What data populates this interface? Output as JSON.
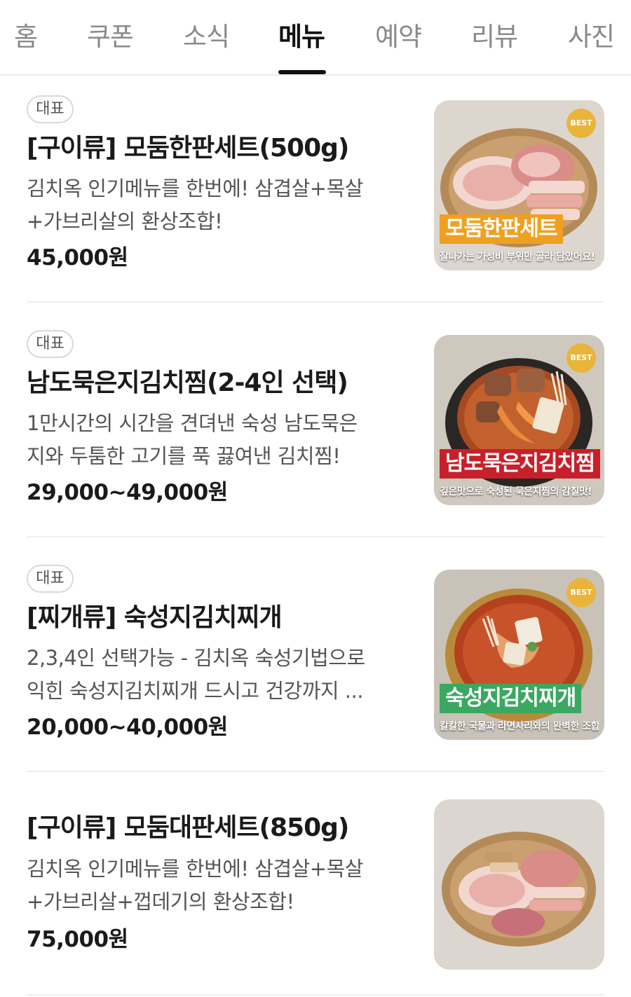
{
  "tabs": [
    {
      "label": "홈",
      "active": false
    },
    {
      "label": "쿠폰",
      "active": false
    },
    {
      "label": "소식",
      "active": false
    },
    {
      "label": "메뉴",
      "active": true
    },
    {
      "label": "예약",
      "active": false
    },
    {
      "label": "리뷰",
      "active": false
    },
    {
      "label": "사진",
      "active": false
    }
  ],
  "menu_items": [
    {
      "badge": "대표",
      "title": "[구이류] 모둠한판세트(500g)",
      "description_line1": "김치옥 인기메뉴를 한번에! 삼겹살+목살",
      "description_line2": "+가브리살의 환상조합!",
      "price": "45,000원",
      "image": {
        "best_badge": "BEST",
        "headline": "모둠한판세트",
        "headline_color": "#f0a020",
        "caption": "잘나가는 가성비 부위만 골라 담았어요!"
      }
    },
    {
      "badge": "대표",
      "title": "남도묵은지김치찜(2-4인 선택)",
      "description_line1": "1만시간의 시간을 견뎌낸 숙성 남도묵은",
      "description_line2": "지와 두툼한 고기를 푹 끓여낸 김치찜!",
      "price": "29,000~49,000원",
      "image": {
        "best_badge": "BEST",
        "headline": "남도묵은지김치찜",
        "headline_color": "#c8202a",
        "caption": "깊은맛으로 숙성된 묵은지찜의 감칠맛!"
      }
    },
    {
      "badge": "대표",
      "title": "[찌개류] 숙성지김치찌개",
      "description_line1": "2,3,4인 선택가능 - 김치옥 숙성기법으로",
      "description_line2": "익힌 숙성지김치찌개 드시고 건강까지 ...",
      "price": "20,000~40,000원",
      "image": {
        "best_badge": "BEST",
        "headline": "숙성지김치찌개",
        "headline_color": "#3aa860",
        "caption": "칼칼한 국물과 라면사리와의 완벽한 조합!"
      }
    },
    {
      "badge": "",
      "title": "[구이류] 모둠대판세트(850g)",
      "description_line1": "김치옥 인기메뉴를 한번에! 삼겹살+목살",
      "description_line2": "+가브리살+껍데기의 환상조합!",
      "price": "75,000원",
      "image": {
        "best_badge": "",
        "headline": "",
        "headline_color": "",
        "caption": ""
      }
    }
  ]
}
